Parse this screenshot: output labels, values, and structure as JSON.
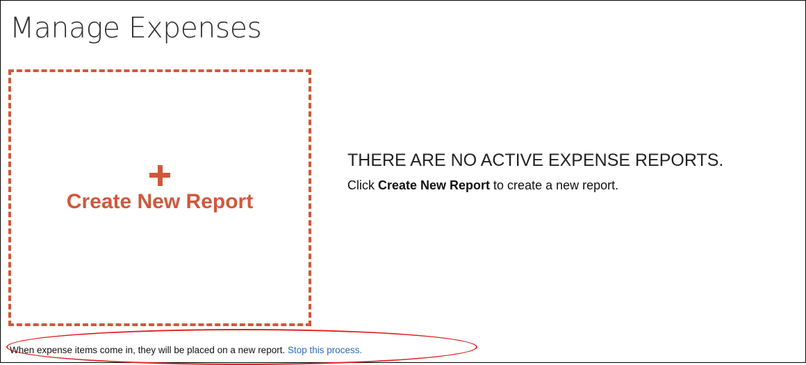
{
  "page": {
    "title": "Manage Expenses"
  },
  "create_card": {
    "icon": "plus-icon",
    "label": "Create New Report",
    "accent_color": "#d0583a"
  },
  "empty_state": {
    "heading": "THERE ARE NO ACTIVE EXPENSE REPORTS.",
    "hint_prefix": "Click ",
    "hint_bold": "Create New Report",
    "hint_suffix": " to create a new report."
  },
  "notice": {
    "text": "When expense items come in, they will be placed on a new report. ",
    "link_label": "Stop this process.",
    "highlight_color": "#e02020",
    "link_color": "#2a6cb5"
  }
}
